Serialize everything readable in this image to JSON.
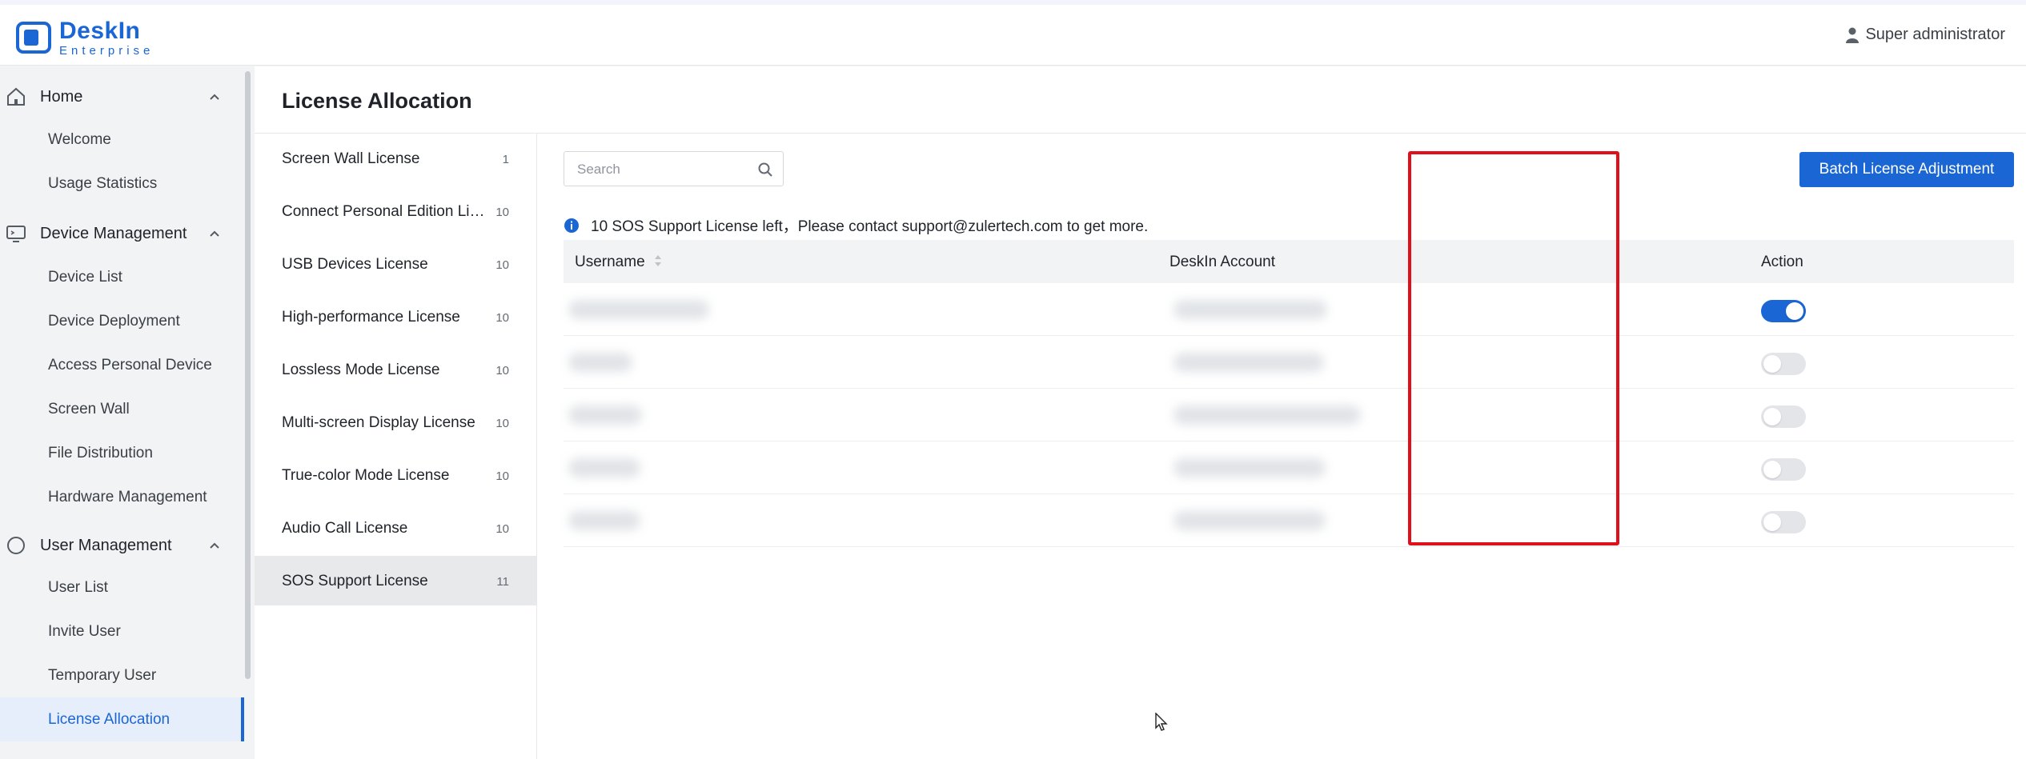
{
  "header": {
    "logo_title": "DeskIn",
    "logo_sub": "Enterprise",
    "user": "Super administrator"
  },
  "sidebar": {
    "groups": [
      {
        "label": "Home",
        "icon": "home-icon",
        "items": [
          "Welcome",
          "Usage Statistics"
        ]
      },
      {
        "label": "Device Management",
        "icon": "monitor-icon",
        "items": [
          "Device List",
          "Device Deployment",
          "Access Personal Device",
          "Screen Wall",
          "File Distribution",
          "Hardware Management"
        ]
      },
      {
        "label": "User Management",
        "icon": "user-circle-icon",
        "items": [
          "User List",
          "Invite User",
          "Temporary User",
          "License Allocation"
        ]
      }
    ],
    "active_item": "License Allocation"
  },
  "page": {
    "title": "License Allocation"
  },
  "licenses": [
    {
      "name": "Screen Wall License",
      "count": "1"
    },
    {
      "name": "Connect Personal Edition License",
      "count": "10"
    },
    {
      "name": "USB Devices License",
      "count": "10"
    },
    {
      "name": "High-performance License",
      "count": "10"
    },
    {
      "name": "Lossless Mode License",
      "count": "10"
    },
    {
      "name": "Multi-screen Display License",
      "count": "10"
    },
    {
      "name": "True-color Mode License",
      "count": "10"
    },
    {
      "name": "Audio Call License",
      "count": "10"
    },
    {
      "name": "SOS Support License",
      "count": "11"
    }
  ],
  "toolbar": {
    "search_placeholder": "Search",
    "batch_button": "Batch License Adjustment"
  },
  "notice": "10 SOS Support License left，Please contact support@zulertech.com to get more.",
  "table": {
    "columns": [
      "Username",
      "DeskIn Account",
      "Action"
    ],
    "rows": [
      {
        "action_enabled": true
      },
      {
        "action_enabled": false
      },
      {
        "action_enabled": false
      },
      {
        "action_enabled": false
      },
      {
        "action_enabled": false
      }
    ]
  },
  "colors": {
    "accent": "#1a66d4",
    "highlight": "#e0101b"
  }
}
